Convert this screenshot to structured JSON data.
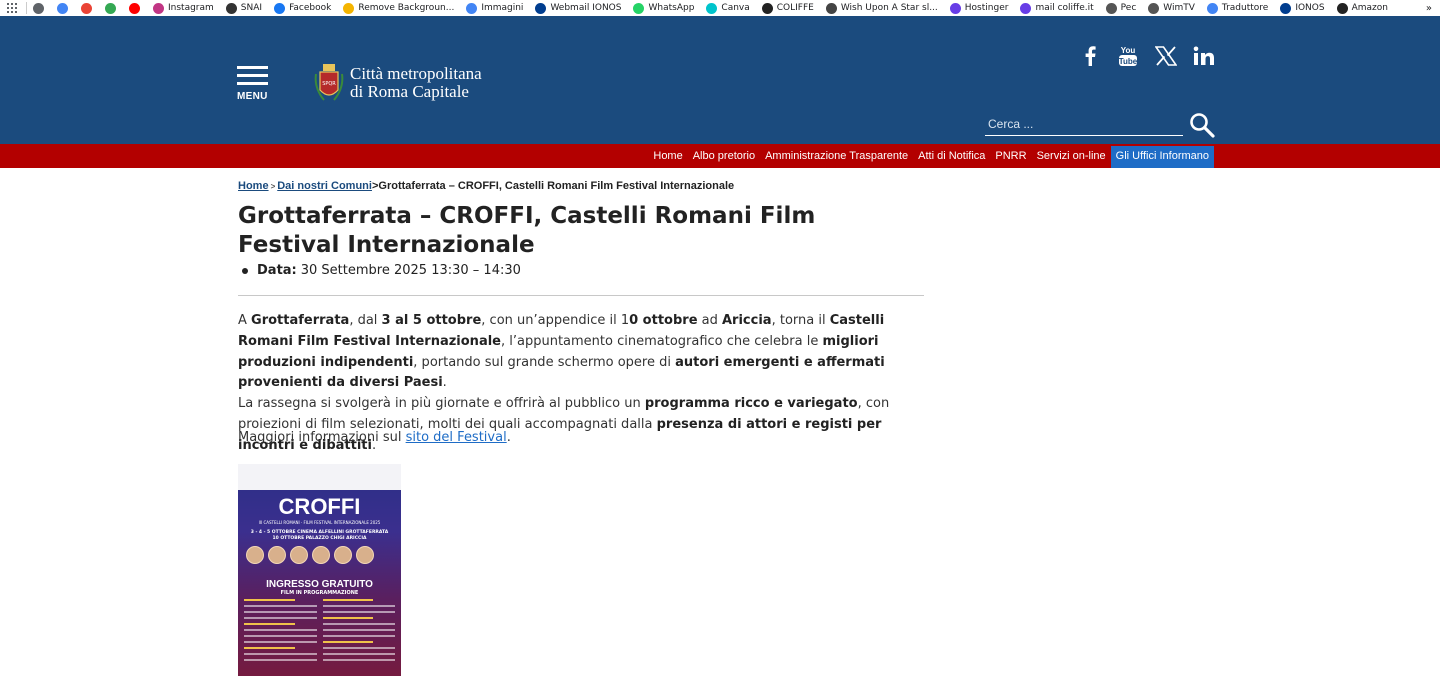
{
  "bookmarks": [
    {
      "label": "",
      "icon": "chrome-icon",
      "color": "#5f6368"
    },
    {
      "label": "",
      "icon": "google-icon",
      "color": "#4285f4"
    },
    {
      "label": "",
      "icon": "gmail-icon",
      "color": "#ea4335"
    },
    {
      "label": "",
      "icon": "drive-icon",
      "color": "#34a853"
    },
    {
      "label": "",
      "icon": "youtube-icon",
      "color": "#ff0000"
    },
    {
      "label": "Instagram",
      "icon": "instagram-icon",
      "color": "#c13584"
    },
    {
      "label": "SNAI",
      "icon": "snai-icon",
      "color": "#333333"
    },
    {
      "label": "Facebook",
      "icon": "facebook-icon",
      "color": "#1877f2"
    },
    {
      "label": "Remove Backgroun...",
      "icon": "removebg-icon",
      "color": "#f4b400"
    },
    {
      "label": "Immagini",
      "icon": "google-icon",
      "color": "#4285f4"
    },
    {
      "label": "Webmail IONOS",
      "icon": "ionos-icon",
      "color": "#003d8f"
    },
    {
      "label": "WhatsApp",
      "icon": "whatsapp-icon",
      "color": "#25d366"
    },
    {
      "label": "Canva",
      "icon": "canva-icon",
      "color": "#00c4cc"
    },
    {
      "label": "COLIFFE",
      "icon": "coliffe-icon",
      "color": "#222222"
    },
    {
      "label": "Wish Upon A Star sl...",
      "icon": "wish-icon",
      "color": "#444444"
    },
    {
      "label": "Hostinger",
      "icon": "hostinger-icon",
      "color": "#673de6"
    },
    {
      "label": "mail coliffe.it",
      "icon": "hostinger-icon",
      "color": "#673de6"
    },
    {
      "label": "Pec",
      "icon": "pec-icon",
      "color": "#555555"
    },
    {
      "label": "WimTV",
      "icon": "globe-icon",
      "color": "#555555"
    },
    {
      "label": "Traduttore",
      "icon": "translate-icon",
      "color": "#4285f4"
    },
    {
      "label": "IONOS",
      "icon": "ionos-icon",
      "color": "#003d8f"
    },
    {
      "label": "Amazon",
      "icon": "amazon-icon",
      "color": "#222222"
    }
  ],
  "bookmarks_more": "»",
  "header": {
    "menu_label": "MENU",
    "logo_line1": "Città metropolitana",
    "logo_line2": "di Roma Capitale",
    "search_placeholder": "Cerca ...",
    "social": [
      "facebook-icon",
      "youtube-icon",
      "x-icon",
      "linkedin-icon"
    ]
  },
  "nav": {
    "items": [
      {
        "label": "Home",
        "active": false
      },
      {
        "label": "Albo pretorio",
        "active": false
      },
      {
        "label": "Amministrazione Trasparente",
        "active": false
      },
      {
        "label": "Atti di Notifica",
        "active": false
      },
      {
        "label": "PNRR",
        "active": false
      },
      {
        "label": "Servizi on-line",
        "active": false
      },
      {
        "label": "Gli Uffici Informano",
        "active": true
      }
    ]
  },
  "breadcrumb": {
    "home": "Home",
    "sep1": ">",
    "section": "Dai nostri Comuni",
    "sep2": ">",
    "current": "Grottaferrata – CROFFI, Castelli Romani Film Festival Internazionale"
  },
  "article": {
    "title": "Grottaferrata – CROFFI, Castelli Romani Film Festival Internazionale",
    "date_label": "Data:",
    "date_value": "30 Settembre 2025 13:30 – 14:30",
    "p1": {
      "t1": "A ",
      "b1": "Grottaferrata",
      "t2": ", dal ",
      "b2": "3 al 5 ottobre",
      "t3": ", con un’appendice il 1",
      "b3": "0 ottobre",
      "t4": " ad ",
      "b4": "Ariccia",
      "t5": ", torna il ",
      "b5": "Castelli Romani Film Festival Internazionale",
      "t6": ", l’appuntamento cinematografico che celebra le ",
      "b6": "migliori produzioni indipendenti",
      "t7": ", portando sul grande schermo opere di ",
      "b7": "autori emergenti e affermati provenienti da diversi Paesi",
      "t8": "."
    },
    "p2": {
      "t1": "La rassegna si svolgerà in più giornate e offrirà al pubblico un ",
      "b1": "programma ricco e variegato",
      "t2": ", con proiezioni di film selezionati, molti dei quali accompagnati dalla ",
      "b2": "presenza di attori e registi per incontri e dibattiti",
      "t3": "."
    },
    "more_text": "Maggiori informazioni sul ",
    "more_link": "sito del Festival",
    "more_end": "."
  },
  "poster": {
    "title": "CROFFI",
    "subtitle": "III CASTELLI ROMANI · FILM FESTIVAL INTERNAZIONALE 2025",
    "dates_line1": "3 - 4 - 5 OTTOBRE CINEMA ALFELLINI GROTTAFERRATA",
    "dates_line2": "10 OTTOBRE PALAZZO CHIGI ARICCIA",
    "entry": "INGRESSO GRATUITO",
    "program": "FILM IN PROGRAMMAZIONE"
  }
}
